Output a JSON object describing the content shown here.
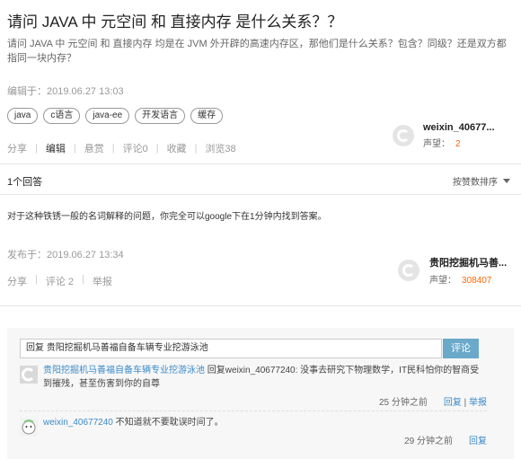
{
  "question": {
    "title": "请问 JAVA 中 元空间 和 直接内存 是什么关系？？",
    "description": "请问 JAVA 中 元空间 和 直接内存 均是在 JVM 外开辟的高速内存区，那他们是什么关系？包含？同级？还是双方都指同一块内存？",
    "edit_time": "编辑于：2019.06.27 13:03",
    "tags": [
      "java",
      "c语言",
      "java-ee",
      "开发语言",
      "缓存"
    ],
    "actions": [
      "分享",
      "编辑",
      "悬赏",
      "评论0",
      "收藏",
      "浏览38"
    ],
    "author": {
      "name": "weixin_40677...",
      "rep_label": "声望：",
      "rep_value": "2"
    }
  },
  "answers_header": {
    "count": "1个回答",
    "sort": "按赞数排序"
  },
  "answer": {
    "text": "对于这种铁锈一般的名词解释的问题，你完全可以google下在1分钟内找到答案。",
    "post_time": "发布于：2019.06.27 13:34",
    "actions": [
      "分享",
      "评论 2",
      "举报"
    ],
    "author": {
      "name": "贵阳挖掘机马善...",
      "rep_label": "声望：",
      "rep_value": "308407"
    }
  },
  "comments": {
    "input_value": "回复 贵阳挖掘机马善福自备车辆专业挖游泳池",
    "submit_label": "评论",
    "items": [
      {
        "user": "贵阳挖掘机马善福自备车辆专业挖游泳池",
        "text": "回复weixin_40677240: 没事去研究下物理数学，IT民科怕你的智商受到摧残，甚至伤害到你的自尊",
        "time": "25 分钟之前",
        "reply": "回复",
        "report": "举报"
      },
      {
        "user": "weixin_40677240",
        "text": "不知道就不要耽误时间了。",
        "time": "29 分钟之前",
        "reply": "回复"
      }
    ]
  },
  "colors": {
    "accent_link": "#3b8bc8",
    "reputation": "#ff6600",
    "button": "#6aa9c9"
  }
}
